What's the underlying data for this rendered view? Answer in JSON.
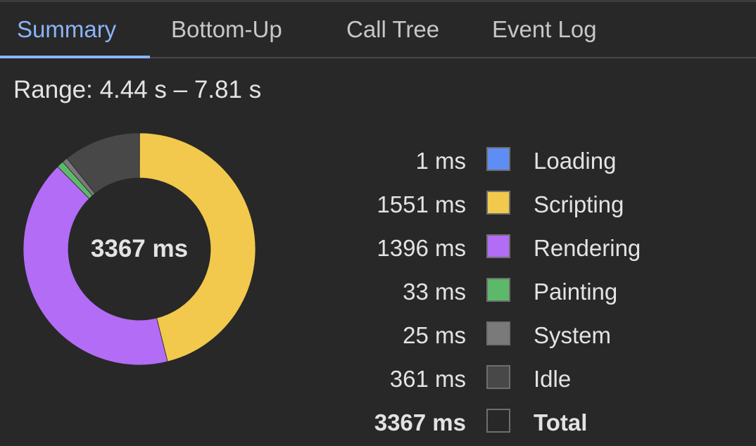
{
  "tabs": [
    {
      "label": "Summary",
      "active": true
    },
    {
      "label": "Bottom-Up",
      "active": false
    },
    {
      "label": "Call Tree",
      "active": false
    },
    {
      "label": "Event Log",
      "active": false
    }
  ],
  "range_label": "Range: 4.44 s – 7.81 s",
  "total_center": "3367 ms",
  "colors": {
    "accent": "#8ab4f8",
    "loading": "#5e8ef5",
    "scripting": "#f2c94c",
    "rendering": "#b26cf5",
    "painting": "#5cb96a",
    "system": "#7a7a7a",
    "idle": "#484848"
  },
  "legend": [
    {
      "value": "1 ms",
      "label": "Loading",
      "ms": 1,
      "color": "#5e8ef5"
    },
    {
      "value": "1551 ms",
      "label": "Scripting",
      "ms": 1551,
      "color": "#f2c94c"
    },
    {
      "value": "1396 ms",
      "label": "Rendering",
      "ms": 1396,
      "color": "#b26cf5"
    },
    {
      "value": "33 ms",
      "label": "Painting",
      "ms": 33,
      "color": "#5cb96a"
    },
    {
      "value": "25 ms",
      "label": "System",
      "ms": 25,
      "color": "#7a7a7a"
    },
    {
      "value": "361 ms",
      "label": "Idle",
      "ms": 361,
      "color": "#484848"
    }
  ],
  "total": {
    "value": "3367 ms",
    "label": "Total"
  }
}
